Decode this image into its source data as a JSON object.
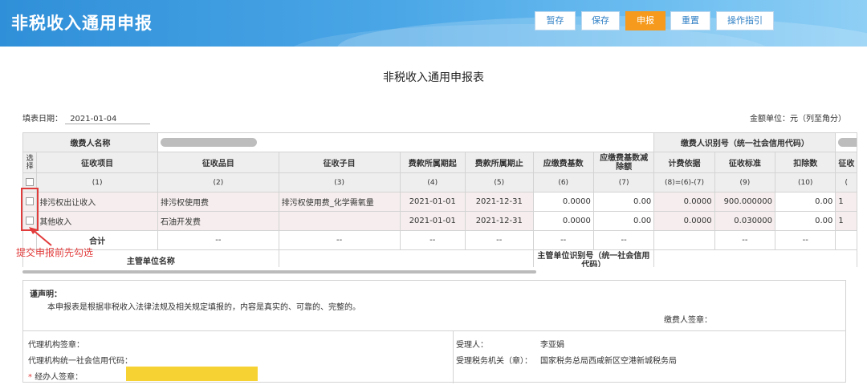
{
  "header": {
    "title": "非税收入通用申报",
    "buttons": [
      {
        "label": "暂存",
        "active": false
      },
      {
        "label": "保存",
        "active": false
      },
      {
        "label": "申报",
        "active": true
      },
      {
        "label": "重置",
        "active": false
      },
      {
        "label": "操作指引",
        "active": false
      }
    ]
  },
  "form": {
    "title": "非税收入通用申报表",
    "fill_date_label": "填表日期：",
    "fill_date": "2021-01-04",
    "amount_unit": "金额单位：元（列至角分）"
  },
  "table": {
    "payer_name_label": "缴费人名称",
    "payer_id_label": "缴费人识别号（统一社会信用代码）",
    "col_select": "选择",
    "columns": [
      "征收项目",
      "征收品目",
      "征收子目",
      "费款所属期起",
      "费款所属期止",
      "应缴费基数",
      "应缴费基数减除额",
      "计费依据",
      "征收标准",
      "扣除数",
      "征收"
    ],
    "col_numbers": [
      "(1)",
      "(2)",
      "(3)",
      "(4)",
      "(5)",
      "(6)",
      "(7)",
      "(8)=(6)-(7)",
      "(9)",
      "(10)",
      "("
    ],
    "rows": [
      {
        "item": "排污权出让收入",
        "category": "排污权使用费",
        "sub": "排污权使用费_化学需氧量",
        "start": "2021-01-01",
        "end": "2021-12-31",
        "base": "0.0000",
        "deduct_base": "0.00",
        "basis": "0.0000",
        "standard": "900.000000",
        "deduction": "0.00",
        "tail": "1"
      },
      {
        "item": "其他收入",
        "category": "石油开发费",
        "sub": "",
        "start": "2021-01-01",
        "end": "2021-12-31",
        "base": "0.0000",
        "deduct_base": "0.00",
        "basis": "0.0000",
        "standard": "0.030000",
        "deduction": "0.00",
        "tail": "1"
      }
    ],
    "total_label": "合计",
    "dash": "--",
    "supervisor_label": "主管单位名称",
    "supervisor_id_label": "主管单位识别号（统一社会信用代码）"
  },
  "annotation": {
    "text": "提交申报前先勾选",
    "color": "#e23b3b"
  },
  "declaration": {
    "title": "谨声明：",
    "text": "本申报表是根据非税收入法律法规及相关规定填报的，内容是真实的、可靠的、完整的。",
    "payer_sign": "缴费人签章：",
    "agent_sign": "代理机构签章：",
    "agent_code": "代理机构统一社会信用代码：",
    "handler_sign": "经办人签章：",
    "handler_required": "*",
    "receiver_label": "受理人：",
    "receiver_name": "李亚娟",
    "authority_label": "受理税务机关（章）：",
    "authority_name": "国家税务总局西咸新区空港新城税务局"
  }
}
